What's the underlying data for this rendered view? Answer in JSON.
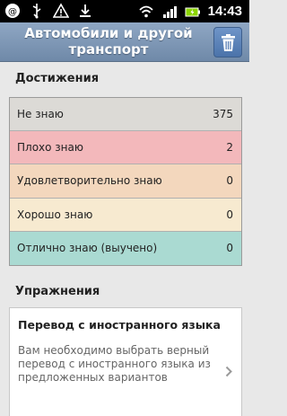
{
  "status_bar": {
    "time": "14:43"
  },
  "header": {
    "title": "Автомобили и другой транспорт"
  },
  "achievements": {
    "section_title": "Достижения",
    "rows": [
      {
        "label": "Не знаю",
        "count": "375",
        "color": "#dcdad6"
      },
      {
        "label": "Плохо знаю",
        "count": "2",
        "color": "#f3b8bb"
      },
      {
        "label": "Удовлетворительно знаю",
        "count": "0",
        "color": "#f3d7bd"
      },
      {
        "label": "Хорошо знаю",
        "count": "0",
        "color": "#f7ead0"
      },
      {
        "label": "Отлично знаю (выучено)",
        "count": "0",
        "color": "#aadad2"
      }
    ]
  },
  "exercises": {
    "section_title": "Упражнения",
    "items": [
      {
        "title": "Перевод с иностранного языка",
        "description": "Вам необходимо выбрать верный перевод с иностранного языка из предложенных вариантов"
      }
    ]
  }
}
